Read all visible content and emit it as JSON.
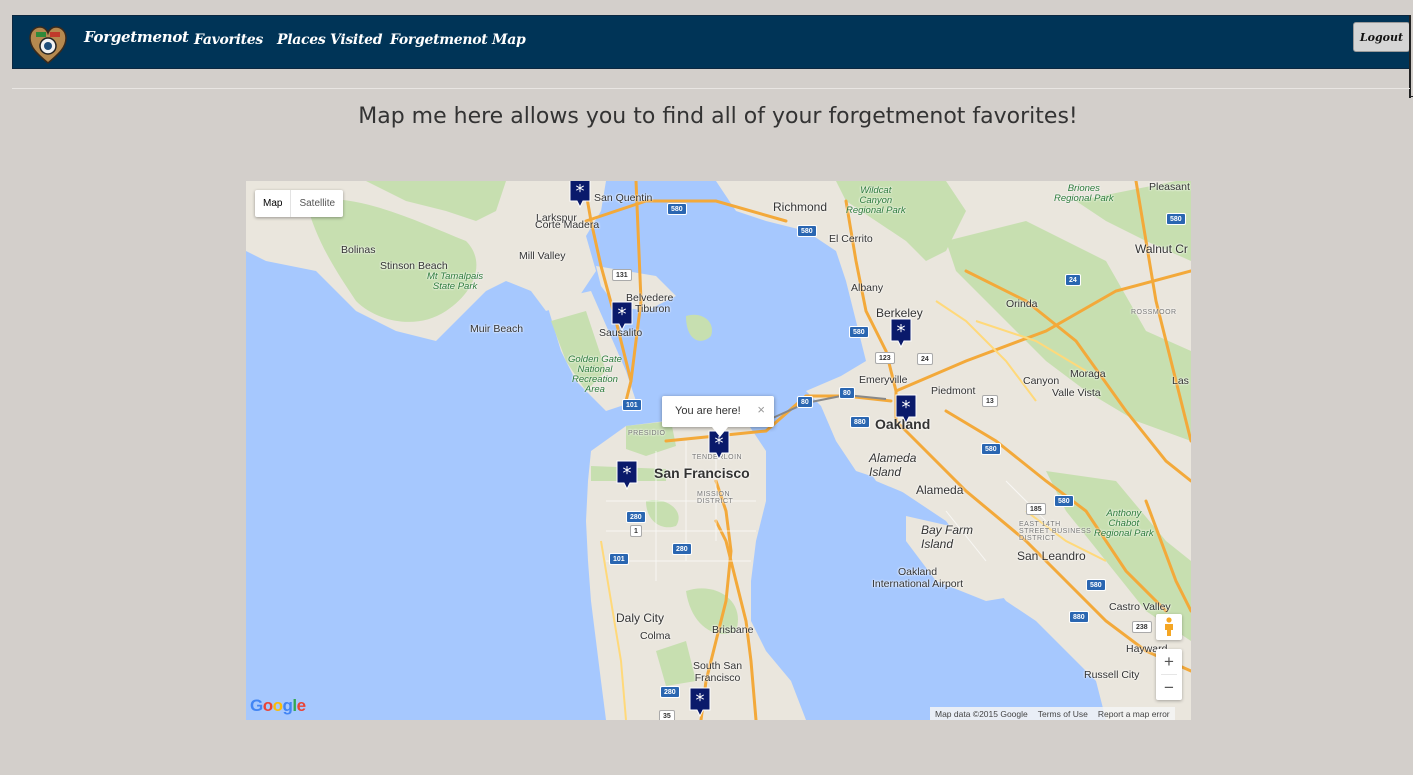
{
  "nav": {
    "brand": "Forgetmenot",
    "links": [
      "Favorites",
      "Places Visited",
      "Forgetmenot Map"
    ],
    "logout": "Logout"
  },
  "page": {
    "title": "Map me here allows you to find all of your forgetmenot favorites!"
  },
  "map": {
    "type_controls": {
      "map": "Map",
      "satellite": "Satellite",
      "active": "Map"
    },
    "info_window": {
      "text": "You are here!",
      "close": "×"
    },
    "zoom": {
      "in": "+",
      "out": "−"
    },
    "logo": "Google",
    "attribution": {
      "data": "Map data ©2015 Google",
      "terms": "Terms of Use",
      "report": "Report a map error"
    },
    "labels": {
      "larkspur": "Larkspur",
      "san_quentin": "San Quentin",
      "corte_madera": "Corte Madera",
      "mill_valley": "Mill Valley",
      "bolinas": "Bolinas",
      "stinson_beach": "Stinson Beach",
      "mt_tam": "Mt Tamalpais\nState Park",
      "belvedere": "Belvedere",
      "tiburon": "Tiburon",
      "muir_beach": "Muir Beach",
      "sausalito": "Sausalito",
      "ggnra": "Golden Gate\nNational\nRecreation\nArea",
      "richmond": "Richmond",
      "el_cerrito": "El Cerrito",
      "wildcat": "Wildcat\nCanyon\nRegional Park",
      "briones": "Briones\nRegional Park",
      "pleasant": "Pleasant",
      "walnut_creek": "Walnut Cr",
      "albany": "Albany",
      "berkeley": "Berkeley",
      "orinda": "Orinda",
      "rossmoor": "ROSSMOOR",
      "emeryville": "Emeryville",
      "piedmont": "Piedmont",
      "canyon": "Canyon",
      "moraga": "Moraga",
      "valle_vista": "Valle Vista",
      "las": "Las",
      "oakland": "Oakland",
      "presidio": "PRESIDIO",
      "tenderloin": "TENDERLOIN",
      "san_francisco": "San Francisco",
      "alameda_island": "Alameda\nIsland",
      "alameda": "Alameda",
      "mission": "MISSION\nDISTRICT",
      "bay_farm": "Bay Farm\nIsland",
      "east14": "EAST 14TH\nSTREET BUSINESS\nDISTRICT",
      "anthony_chabot": "Anthony\nChabot\nRegional Park",
      "san_leandro": "San Leandro",
      "oakland_airport": "Oakland\nInternational Airport",
      "castro_valley": "Castro Valley",
      "daly_city": "Daly City",
      "colma": "Colma",
      "brisbane": "Brisbane",
      "south_sf": "South San\nFrancisco",
      "hayward": "Hayward",
      "russell_city": "Russell City"
    },
    "shields": [
      "580",
      "580",
      "580",
      "131",
      "101",
      "101",
      "80",
      "80",
      "880",
      "880",
      "580",
      "24",
      "123",
      "13",
      "580",
      "185",
      "580",
      "580",
      "880",
      "238",
      "280",
      "280",
      "280",
      "35",
      "1",
      "1",
      "680",
      "680",
      "24"
    ]
  }
}
